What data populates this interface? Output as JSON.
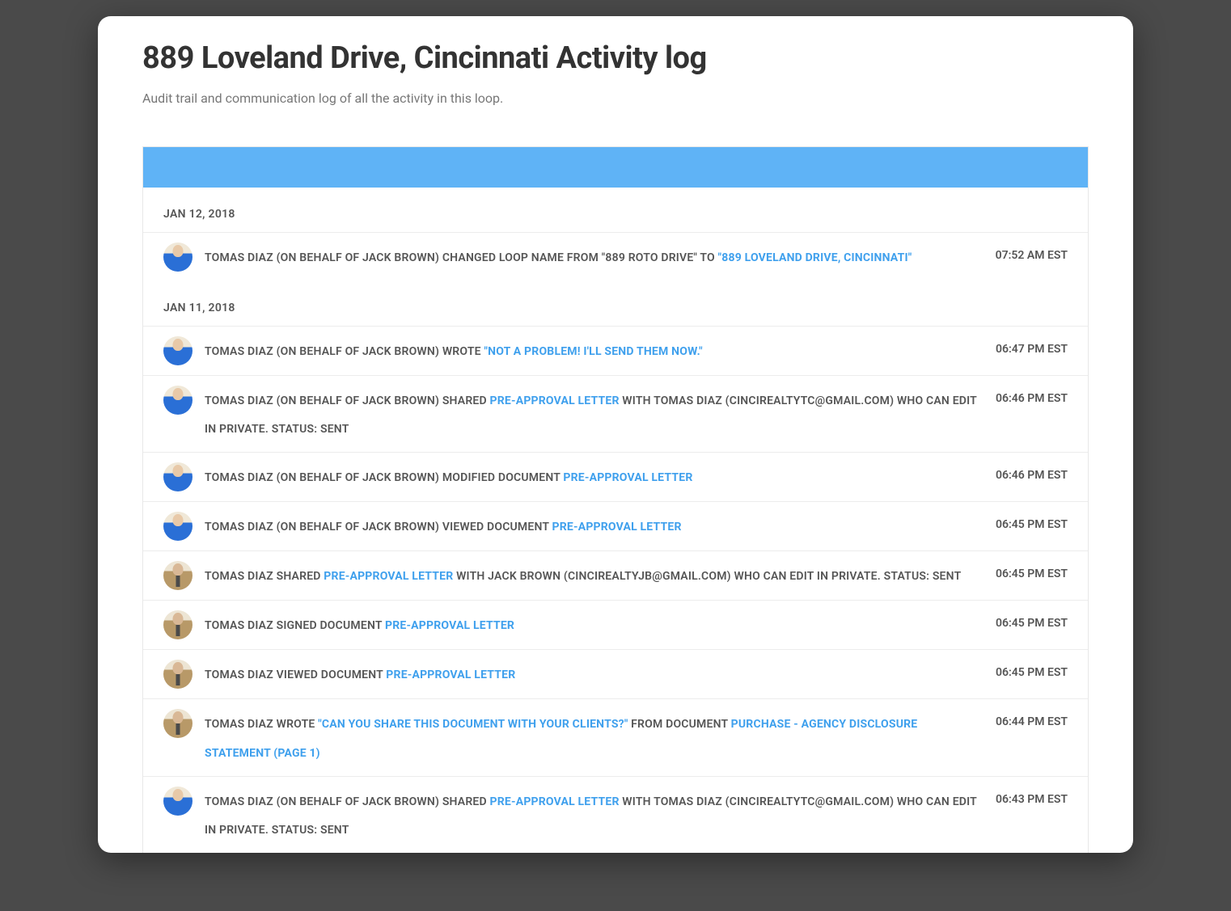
{
  "header": {
    "title": "889 Loveland Drive, Cincinnati Activity log",
    "subtitle": "Audit trail and communication log of all the activity in this loop."
  },
  "dates": [
    {
      "label": "JAN 12, 2018",
      "entries": [
        {
          "avatar": "blue-shirt",
          "time": "07:52 AM EST",
          "segments": [
            {
              "text": "TOMAS DIAZ (ON BEHALF OF JACK BROWN) CHANGED LOOP NAME FROM \"889 ROTO DRIVE\" TO ",
              "link": false
            },
            {
              "text": "\"889 LOVELAND DRIVE, CINCINNATI\"",
              "link": true
            }
          ]
        }
      ]
    },
    {
      "label": "JAN 11, 2018",
      "entries": [
        {
          "avatar": "blue-shirt",
          "time": "06:47 PM EST",
          "segments": [
            {
              "text": "TOMAS DIAZ (ON BEHALF OF JACK BROWN) WROTE ",
              "link": false
            },
            {
              "text": "\"NOT A PROBLEM! I'LL SEND THEM NOW.\"",
              "link": true
            }
          ]
        },
        {
          "avatar": "blue-shirt",
          "time": "06:46 PM EST",
          "segments": [
            {
              "text": "TOMAS DIAZ (ON BEHALF OF JACK BROWN) SHARED ",
              "link": false
            },
            {
              "text": "PRE-APPROVAL LETTER",
              "link": true
            },
            {
              "text": " WITH TOMAS DIAZ (CINCIREALTYTC@GMAIL.COM) WHO CAN EDIT IN PRIVATE. STATUS: SENT",
              "link": false
            }
          ]
        },
        {
          "avatar": "blue-shirt",
          "time": "06:46 PM EST",
          "segments": [
            {
              "text": "TOMAS DIAZ (ON BEHALF OF JACK BROWN) MODIFIED DOCUMENT ",
              "link": false
            },
            {
              "text": "PRE-APPROVAL LETTER",
              "link": true
            }
          ]
        },
        {
          "avatar": "blue-shirt",
          "time": "06:45 PM EST",
          "segments": [
            {
              "text": "TOMAS DIAZ (ON BEHALF OF JACK BROWN) VIEWED DOCUMENT ",
              "link": false
            },
            {
              "text": "PRE-APPROVAL LETTER",
              "link": true
            }
          ]
        },
        {
          "avatar": "tan-suit",
          "time": "06:45 PM EST",
          "segments": [
            {
              "text": "TOMAS DIAZ SHARED ",
              "link": false
            },
            {
              "text": "PRE-APPROVAL LETTER",
              "link": true
            },
            {
              "text": " WITH JACK BROWN (CINCIREALTYJB@GMAIL.COM) WHO CAN EDIT IN PRIVATE. STATUS: SENT",
              "link": false
            }
          ]
        },
        {
          "avatar": "tan-suit",
          "time": "06:45 PM EST",
          "segments": [
            {
              "text": "TOMAS DIAZ SIGNED DOCUMENT ",
              "link": false
            },
            {
              "text": "PRE-APPROVAL LETTER",
              "link": true
            }
          ]
        },
        {
          "avatar": "tan-suit",
          "time": "06:45 PM EST",
          "segments": [
            {
              "text": "TOMAS DIAZ VIEWED DOCUMENT ",
              "link": false
            },
            {
              "text": "PRE-APPROVAL LETTER",
              "link": true
            }
          ]
        },
        {
          "avatar": "tan-suit",
          "time": "06:44 PM EST",
          "segments": [
            {
              "text": "TOMAS DIAZ WROTE ",
              "link": false
            },
            {
              "text": "\"CAN YOU SHARE THIS DOCUMENT WITH YOUR CLIENTS?\"",
              "link": true
            },
            {
              "text": " FROM DOCUMENT ",
              "link": false
            },
            {
              "text": "PURCHASE - AGENCY DISCLOSURE STATEMENT (PAGE 1)",
              "link": true
            }
          ]
        },
        {
          "avatar": "blue-shirt",
          "time": "06:43 PM EST",
          "segments": [
            {
              "text": "TOMAS DIAZ (ON BEHALF OF JACK BROWN) SHARED ",
              "link": false
            },
            {
              "text": "PRE-APPROVAL LETTER",
              "link": true
            },
            {
              "text": " WITH TOMAS DIAZ (CINCIREALTYTC@GMAIL.COM) WHO CAN EDIT IN PRIVATE. STATUS: SENT",
              "link": false
            }
          ]
        }
      ]
    }
  ]
}
